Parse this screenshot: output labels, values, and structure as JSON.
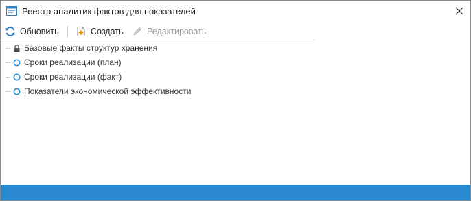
{
  "window": {
    "title": "Реестр аналитик фактов для показателей"
  },
  "toolbar": {
    "refresh_label": "Обновить",
    "create_label": "Создать",
    "edit_label": "Редактировать"
  },
  "tree": {
    "items": [
      {
        "label": "Базовые факты структур хранения",
        "icon": "lock-icon"
      },
      {
        "label": "Сроки реализации (план)",
        "icon": "circle-icon"
      },
      {
        "label": "Сроки реализации (факт)",
        "icon": "circle-icon"
      },
      {
        "label": "Показатели экономической эффективности",
        "icon": "circle-icon"
      }
    ]
  },
  "colors": {
    "accent": "#2b89cf",
    "refresh_icon": "#1f77c4",
    "circle_icon": "#2a8bd0"
  }
}
